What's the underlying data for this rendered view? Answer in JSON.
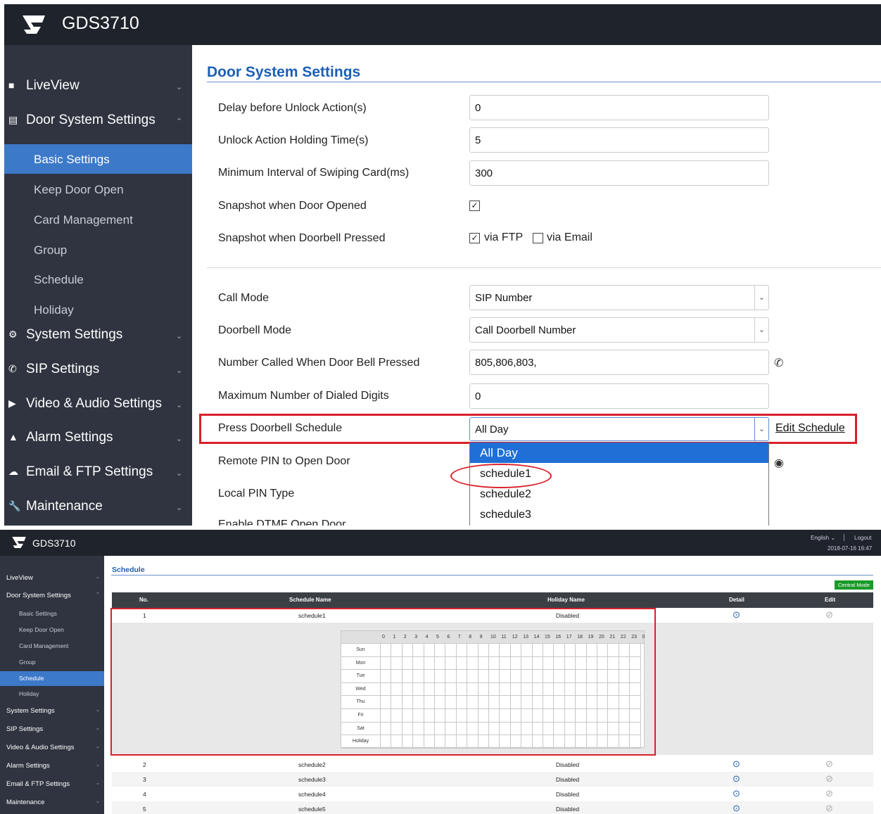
{
  "top": {
    "app_title": "GDS3710",
    "nav": [
      {
        "label": "LiveView",
        "icon": "monitor-icon"
      },
      {
        "label": "Door System Settings",
        "icon": "card-icon"
      },
      {
        "label": "System Settings",
        "icon": "wrench-gear-icon"
      },
      {
        "label": "SIP Settings",
        "icon": "phone-icon"
      },
      {
        "label": "Video & Audio Settings",
        "icon": "video-icon"
      },
      {
        "label": "Alarm Settings",
        "icon": "bell-icon"
      },
      {
        "label": "Email & FTP Settings",
        "icon": "cloud-icon"
      },
      {
        "label": "Maintenance",
        "icon": "wrench-icon"
      }
    ],
    "subnav": [
      "Basic Settings",
      "Keep Door Open",
      "Card Management",
      "Group",
      "Schedule",
      "Holiday"
    ],
    "page_title": "Door System Settings",
    "fields": {
      "delay_label": "Delay before Unlock Action(s)",
      "delay_value": "0",
      "holding_label": "Unlock Action Holding Time(s)",
      "holding_value": "5",
      "interval_label": "Minimum Interval of Swiping Card(ms)",
      "interval_value": "300",
      "snapshot_open_label": "Snapshot when Door Opened",
      "snapshot_bell_label": "Snapshot when Doorbell Pressed",
      "via_ftp": "via FTP",
      "via_email": "via Email",
      "call_mode_label": "Call Mode",
      "call_mode_value": "SIP Number",
      "doorbell_mode_label": "Doorbell Mode",
      "doorbell_mode_value": "Call Doorbell Number",
      "number_called_label": "Number Called When Door Bell Pressed",
      "number_called_value": "805,806,803,",
      "max_digits_label": "Maximum Number of Dialed Digits",
      "max_digits_value": "0",
      "schedule_label": "Press Doorbell Schedule",
      "schedule_value": "All Day",
      "edit_schedule": "Edit Schedule",
      "remote_pin_label": "Remote PIN to Open Door",
      "local_pin_label": "Local PIN Type",
      "dtmf_label": "Enable DTMF Open Door"
    },
    "dropdown_options": [
      "All Day",
      "schedule1",
      "schedule2",
      "schedule3"
    ]
  },
  "bottom": {
    "app_title": "GDS3710",
    "language": "English",
    "logout": "Logout",
    "datetime": "2018-07-16 16:47",
    "nav": [
      "LiveView",
      "Door System Settings",
      "System Settings",
      "SIP Settings",
      "Video & Audio Settings",
      "Alarm Settings",
      "Email & FTP Settings",
      "Maintenance"
    ],
    "subnav": [
      "Basic Settings",
      "Keep Door Open",
      "Card Management",
      "Group",
      "Schedule",
      "Holiday"
    ],
    "page_title": "Schedule",
    "central_mode": "Central Mode",
    "columns": [
      "No.",
      "Schedule Name",
      "Holiday Name",
      "Detail",
      "Edit"
    ],
    "rows": [
      {
        "no": "1",
        "name": "schedule1",
        "holiday": "Disabled"
      },
      {
        "no": "2",
        "name": "schedule2",
        "holiday": "Disabled"
      },
      {
        "no": "3",
        "name": "schedule3",
        "holiday": "Disabled"
      },
      {
        "no": "4",
        "name": "schedule4",
        "holiday": "Disabled"
      },
      {
        "no": "5",
        "name": "schedule5",
        "holiday": "Disabled"
      }
    ],
    "hours": [
      "0",
      "1",
      "2",
      "3",
      "4",
      "5",
      "6",
      "7",
      "8",
      "9",
      "10",
      "11",
      "12",
      "13",
      "14",
      "15",
      "16",
      "17",
      "18",
      "19",
      "20",
      "21",
      "22",
      "23",
      "0"
    ],
    "days": [
      "Sun",
      "Mon",
      "Tue",
      "Wed",
      "Thu",
      "Fri",
      "Sat",
      "Holiday"
    ]
  },
  "colors": {
    "accent": "#3d79c9",
    "header": "#1f232b",
    "sidebar": "#2f3440",
    "highlight": "#d9202b",
    "central_mode": "#1a9a28"
  }
}
